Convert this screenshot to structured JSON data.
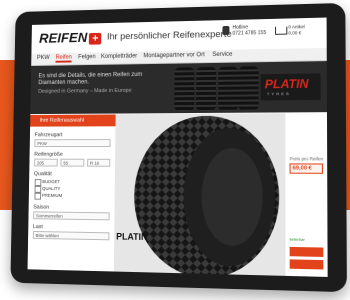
{
  "header": {
    "logo": "REIFEN",
    "logo_plus": "+",
    "tagline": "Ihr persönlicher Reifenexperte",
    "hotline": "Hotline\n0721 4785 155",
    "cart": "0 Artikel\n0,00 €"
  },
  "nav": [
    "PKW",
    "Reifen",
    "Felgen",
    "Kompletträder",
    "Montagepartner vor Ort",
    "Service"
  ],
  "nav_active_index": 1,
  "banner": {
    "line1": "Es sind die Details, die einen Reifen zum Diamanten machen.",
    "line2": "Designed in Germany – Made in Europe",
    "brand_logo": "PLATIN",
    "brand_sub": "TYRES"
  },
  "sidebar": {
    "title": "Ihre Reifenauswahl",
    "fahrzeugart_label": "Fahrzeugart",
    "fahrzeugart_value": "PKW",
    "reifengroesse_label": "Reifengröße",
    "size_width": "205",
    "size_ratio": "55",
    "size_rim": "R 16",
    "qualitaet_label": "Qualität",
    "quality_options": [
      "BUDGET",
      "QUALITY",
      "PREMIUM"
    ],
    "saison_label": "Saison",
    "saison_value": "Sommerreifen",
    "last_label": "Last",
    "last_value": "Bitte wählen"
  },
  "product": {
    "brand": "PLATIN"
  },
  "rightcol": {
    "price_label": "Preis pro Reifen",
    "price": "69,00 €",
    "stock": "lieferbar"
  },
  "colors": {
    "accent": "#e2431b",
    "band": "#e8571d",
    "tablet": "#1c1c1c"
  }
}
